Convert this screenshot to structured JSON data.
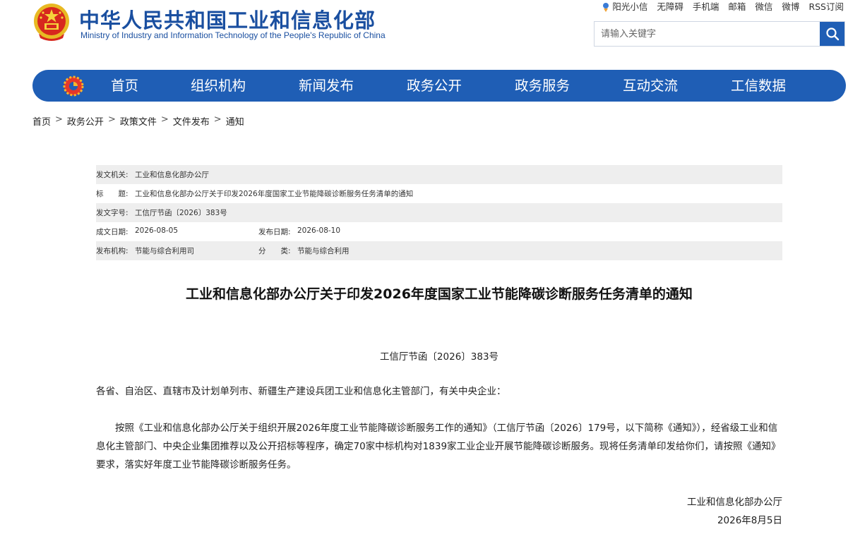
{
  "header": {
    "title_cn": "中华人民共和国工业和信息化部",
    "title_en": "Ministry of Industry and Information Technology of the People's Republic of China",
    "emblem_icon": "national-emblem-icon",
    "brand_color": "#1a4fa0",
    "top_links": [
      "阳光小信",
      "无障碍",
      "手机端",
      "邮箱",
      "微信",
      "微博",
      "RSS订阅"
    ],
    "search": {
      "placeholder": "请输入关键字",
      "icon": "search-icon"
    }
  },
  "nav": {
    "color": "#1f5eb5",
    "logo_icon": "gear-logo-icon",
    "items": [
      "首页",
      "组织机构",
      "新闻发布",
      "政务公开",
      "政务服务",
      "互动交流",
      "工信数据"
    ]
  },
  "breadcrumb": [
    "首页",
    "政务公开",
    "政策文件",
    "文件发布",
    "通知"
  ],
  "breadcrumb_sep": ">",
  "meta": {
    "issuer_label": "发文机关:",
    "issuer": "工业和信息化部办公厅",
    "title_label": "标　　题:",
    "title": "工业和信息化部办公厅关于印发2026年度国家工业节能降碳诊断服务任务清单的通知",
    "docno_label": "发文字号:",
    "docno": "工信厅节函〔2026〕383号",
    "created_label": "成文日期:",
    "created": "2026-08-05",
    "published_label": "发布日期:",
    "published": "2026-08-10",
    "agency_label": "发布机构:",
    "agency": "节能与综合利用司",
    "category_label": "分　　类:",
    "category": "节能与综合利用"
  },
  "article": {
    "title": "工业和信息化部办公厅关于印发2026年度国家工业节能降碳诊断服务任务清单的通知",
    "docno": "工信厅节函〔2026〕383号",
    "salutation": "各省、自治区、直辖市及计划单列市、新疆生产建设兵团工业和信息化主管部门，有关中央企业：",
    "body": "按照《工业和信息化部办公厅关于组织开展2026年度工业节能降碳诊断服务工作的通知》（工信厅节函〔2026〕179号，以下简称《通知》），经省级工业和信息化主管部门、中央企业集团推荐以及公开招标等程序，确定70家中标机构对1839家工业企业开展节能降碳诊断服务。现将任务清单印发给你们，请按照《通知》要求，落实好年度工业节能降碳诊断服务任务。",
    "signer": "工业和信息化部办公厅",
    "date": "2026年8月5日"
  }
}
